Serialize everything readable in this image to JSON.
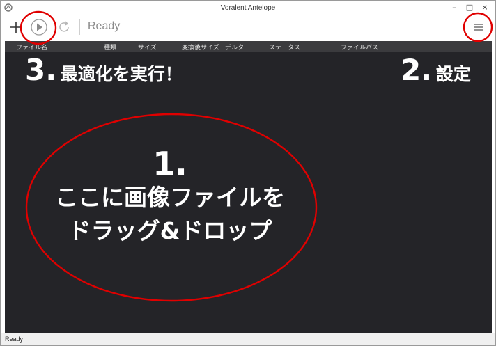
{
  "window": {
    "title": "Voralent Antelope",
    "minimize": "–",
    "maximize": "□",
    "close": "×"
  },
  "toolbar": {
    "status_text": "Ready"
  },
  "columns": [
    "ファイル名",
    "種類",
    "サイズ",
    "変換後サイズ",
    "デルタ",
    "ステータス",
    "ファイルパス"
  ],
  "annotations": {
    "step3": {
      "num": "3.",
      "label": "最適化を実行！"
    },
    "step2": {
      "num": "2.",
      "label": "設定"
    },
    "step1": {
      "num": "1.",
      "line1": "ここに画像ファイルを",
      "line2": "ドラッグ&ドロップ"
    }
  },
  "statusbar": {
    "text": "Ready"
  },
  "colors": {
    "list_bg": "#242428",
    "header_bg": "#3b3b3e",
    "annotation_red": "#e00000"
  }
}
